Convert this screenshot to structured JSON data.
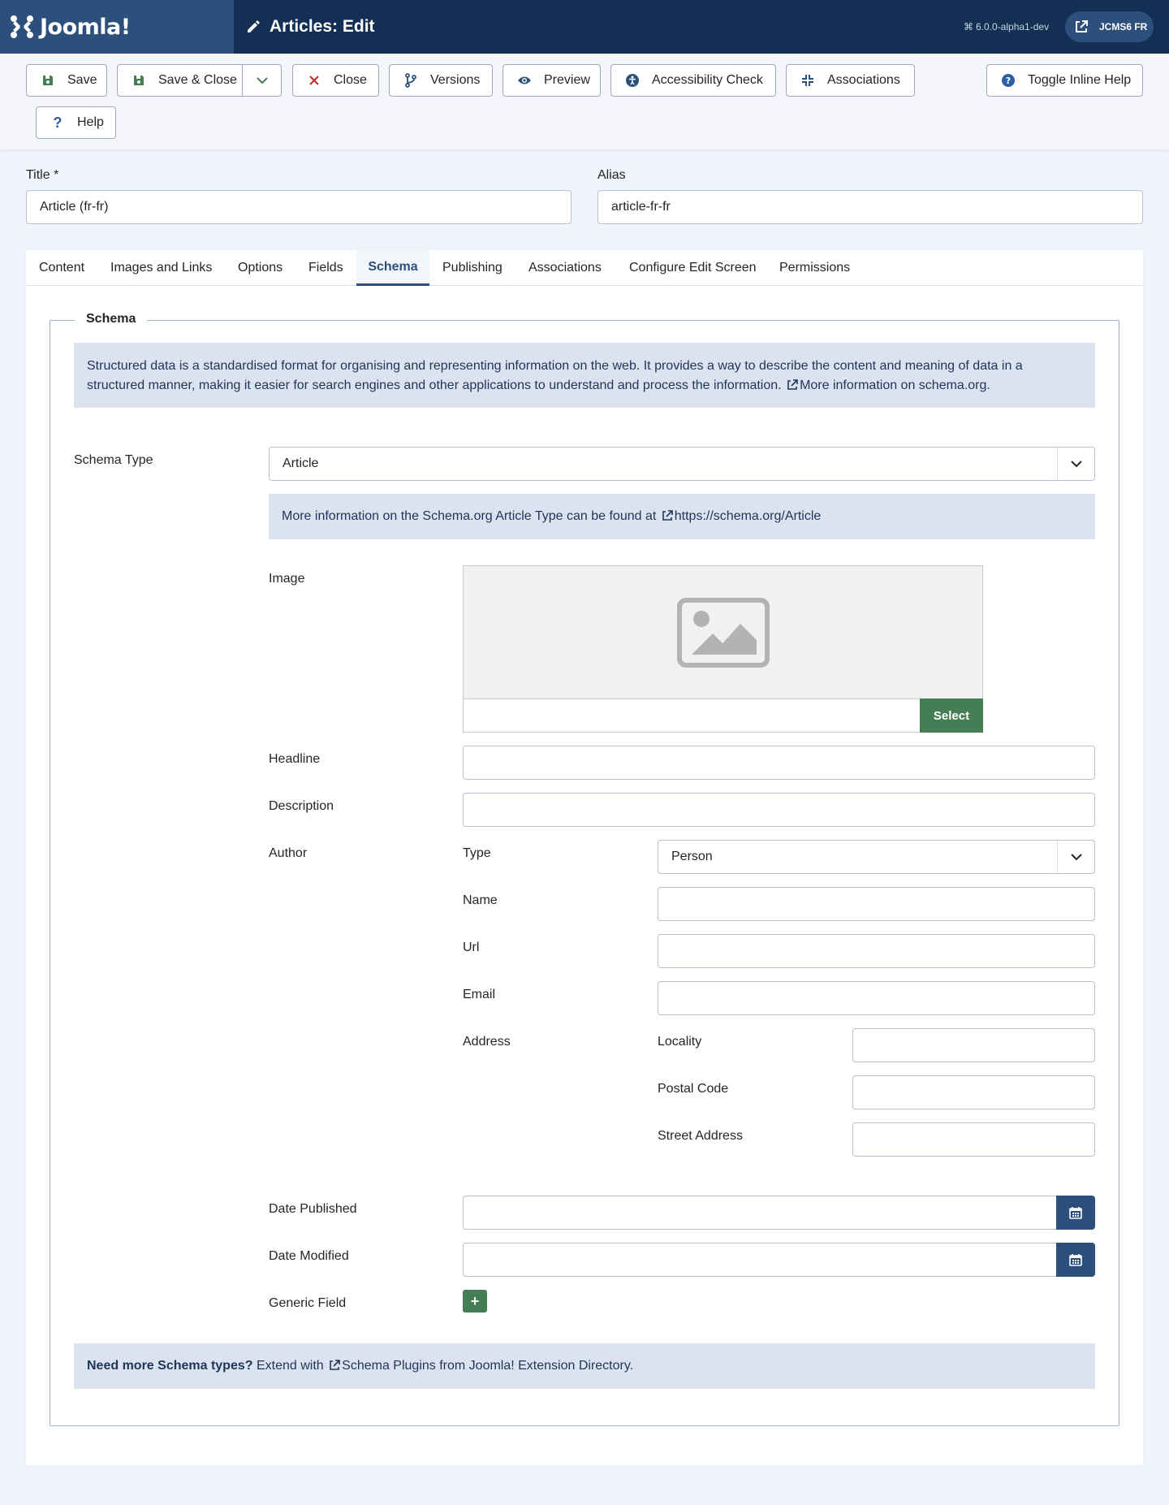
{
  "header": {
    "brand": "Joomla!",
    "page_title": "Articles: Edit",
    "version": "6.0.0-alpha1-dev",
    "site_button": "JCMS6 FR"
  },
  "toolbar": {
    "save": "Save",
    "save_close": "Save & Close",
    "close": "Close",
    "versions": "Versions",
    "preview": "Preview",
    "accessibility": "Accessibility Check",
    "associations": "Associations",
    "toggle_help": "Toggle Inline Help",
    "help": "Help"
  },
  "form": {
    "title_label": "Title *",
    "title_value": "Article (fr-fr)",
    "alias_label": "Alias",
    "alias_value": "article-fr-fr"
  },
  "tabs": [
    {
      "label": "Content"
    },
    {
      "label": "Images and Links"
    },
    {
      "label": "Options"
    },
    {
      "label": "Fields"
    },
    {
      "label": "Schema"
    },
    {
      "label": "Publishing"
    },
    {
      "label": "Associations"
    },
    {
      "label": "Configure Edit Screen"
    },
    {
      "label": "Permissions"
    }
  ],
  "active_tab": "Schema",
  "schema": {
    "legend": "Schema",
    "intro": "Structured data is a standardised format for organising and representing information on the web. It provides a way to describe the content and meaning of data in a structured manner, making it easier for search engines and other applications to understand and process the information.",
    "intro_link": "More information on schema.org.",
    "type_label": "Schema Type",
    "type_value": "Article",
    "type_info": "More information on the Schema.org Article Type can be found at",
    "type_info_link": "https://schema.org/Article",
    "image_label": "Image",
    "select_button": "Select",
    "headline_label": "Headline",
    "description_label": "Description",
    "author_label": "Author",
    "author_type_label": "Type",
    "author_type_value": "Person",
    "author_name_label": "Name",
    "author_url_label": "Url",
    "author_email_label": "Email",
    "address_label": "Address",
    "locality_label": "Locality",
    "postal_code_label": "Postal Code",
    "street_label": "Street Address",
    "date_published_label": "Date Published",
    "date_modified_label": "Date Modified",
    "generic_field_label": "Generic Field",
    "generic_add": "+",
    "more_bold": "Need more Schema types?",
    "more_text": "Extend with",
    "more_link": "Schema Plugins from Joomla! Extension Directory."
  },
  "colors": {
    "header_bg": "#132f53",
    "brand_bg": "#2c4f7c",
    "success": "#457d54",
    "alert_bg": "#dbe3f0"
  }
}
